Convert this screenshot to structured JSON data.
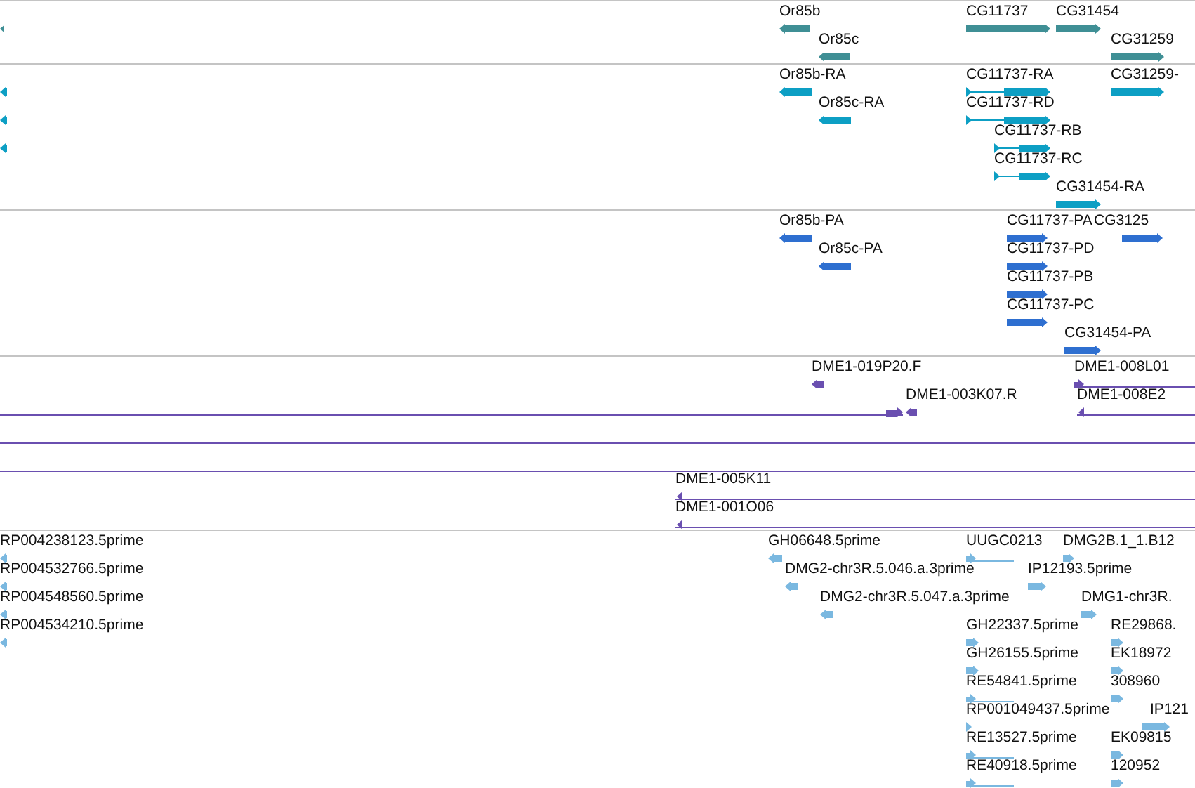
{
  "tracks": [
    {
      "color": "#3f8f95",
      "features": [
        {
          "reverse": true
        },
        {
          "label": "Or85b",
          "reverse": true
        },
        {
          "label": "Or85c",
          "reverse": true
        },
        {
          "label": "CG11737",
          "reverse": false
        },
        {
          "label": "CG31454",
          "reverse": false
        },
        {
          "label": "CG31259",
          "reverse": false
        }
      ]
    },
    {
      "color": "#0d9fc4",
      "features": [
        {
          "reverse": true
        },
        {
          "reverse": true
        },
        {
          "reverse": true
        },
        {
          "label": "Or85b-RA",
          "reverse": true
        },
        {
          "label": "Or85c-RA",
          "reverse": true
        },
        {
          "label": "CG11737-RA",
          "reverse": false
        },
        {
          "label": "CG11737-RD",
          "reverse": false
        },
        {
          "label": "CG11737-RB",
          "reverse": false
        },
        {
          "label": "CG11737-RC",
          "reverse": false
        },
        {
          "label": "CG31454-RA",
          "reverse": false
        },
        {
          "label": "CG31259-",
          "reverse": false
        }
      ]
    },
    {
      "color": "#2e6fd0",
      "features": [
        {
          "label": "Or85b-PA",
          "reverse": true
        },
        {
          "label": "Or85c-PA",
          "reverse": true
        },
        {
          "label": "CG11737-PA",
          "reverse": false
        },
        {
          "label": "CG3125",
          "reverse": false
        },
        {
          "label": "CG11737-PD",
          "reverse": false
        },
        {
          "label": "CG11737-PB",
          "reverse": false
        },
        {
          "label": "CG11737-PC",
          "reverse": false
        },
        {
          "label": "CG31454-PA",
          "reverse": false
        }
      ]
    },
    {
      "color": "#6a4fb0",
      "features": [
        {
          "kind": "arrow",
          "label": "DME1-019P20.F",
          "reverse": true
        },
        {
          "kind": "span",
          "label": "DME1-008L01",
          "reverse": false
        },
        {
          "kind": "span",
          "reverse": false
        },
        {
          "kind": "arrow",
          "label": "DME1-003K07.R",
          "reverse": true
        },
        {
          "kind": "span",
          "label": "DME1-008E2",
          "reverse": true
        },
        {
          "kind": "line"
        },
        {
          "kind": "line"
        },
        {
          "kind": "span",
          "label": "DME1-005K11",
          "reverse": true
        },
        {
          "kind": "span",
          "label": "DME1-001O06",
          "reverse": true
        }
      ]
    },
    {
      "color": "#7ab8e0",
      "features": [
        {
          "label": "RP004238123.5prime",
          "reverse": true
        },
        {
          "label": "RP004532766.5prime",
          "reverse": true
        },
        {
          "label": "RP004548560.5prime",
          "reverse": true
        },
        {
          "label": "RP004534210.5prime",
          "reverse": true
        },
        {
          "label": "GH06648.5prime",
          "reverse": true
        },
        {
          "label": "UUGC0213",
          "reverse": false
        },
        {
          "label": "DMG2B.1_1.B12",
          "reverse": false
        },
        {
          "label": "DMG2-chr3R.5.046.a.3prime",
          "reverse": true
        },
        {
          "label": "IP12193.5prime",
          "reverse": false
        },
        {
          "label": "DMG2-chr3R.5.047.a.3prime",
          "reverse": true
        },
        {
          "label": "DMG1-chr3R.",
          "reverse": false
        },
        {
          "label": "GH22337.5prime",
          "reverse": false
        },
        {
          "label": "RE29868.",
          "reverse": false
        },
        {
          "label": "GH26155.5prime",
          "reverse": false
        },
        {
          "label": "EK18972",
          "reverse": false
        },
        {
          "label": "RE54841.5prime",
          "reverse": false
        },
        {
          "label": "308960",
          "reverse": false
        },
        {
          "label": "RP001049437.5prime",
          "reverse": false
        },
        {
          "label": "IP121",
          "reverse": false
        },
        {
          "label": "RE13527.5prime",
          "reverse": false
        },
        {
          "label": "EK09815",
          "reverse": false
        },
        {
          "label": "RE40918.5prime",
          "reverse": false
        },
        {
          "label": "120952",
          "reverse": false
        }
      ]
    }
  ]
}
